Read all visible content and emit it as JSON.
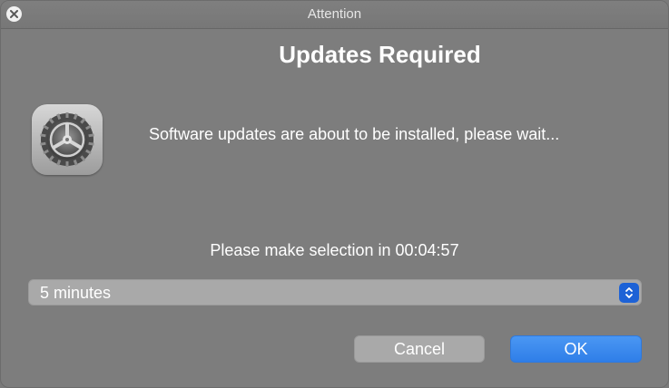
{
  "window": {
    "title": "Attention"
  },
  "dialog": {
    "heading": "Updates Required",
    "icon": "system-preferences-gear-icon",
    "message": "Software updates are about to be installed, please wait...",
    "countdown_prefix": "Please make selection in",
    "countdown_time": "00:04:57"
  },
  "select": {
    "value": "5 minutes"
  },
  "buttons": {
    "cancel": "Cancel",
    "ok": "OK"
  },
  "colors": {
    "background": "#7d7d7d",
    "accent": "#2f7ee8",
    "select_arrow_bg": "#1d62d6"
  }
}
